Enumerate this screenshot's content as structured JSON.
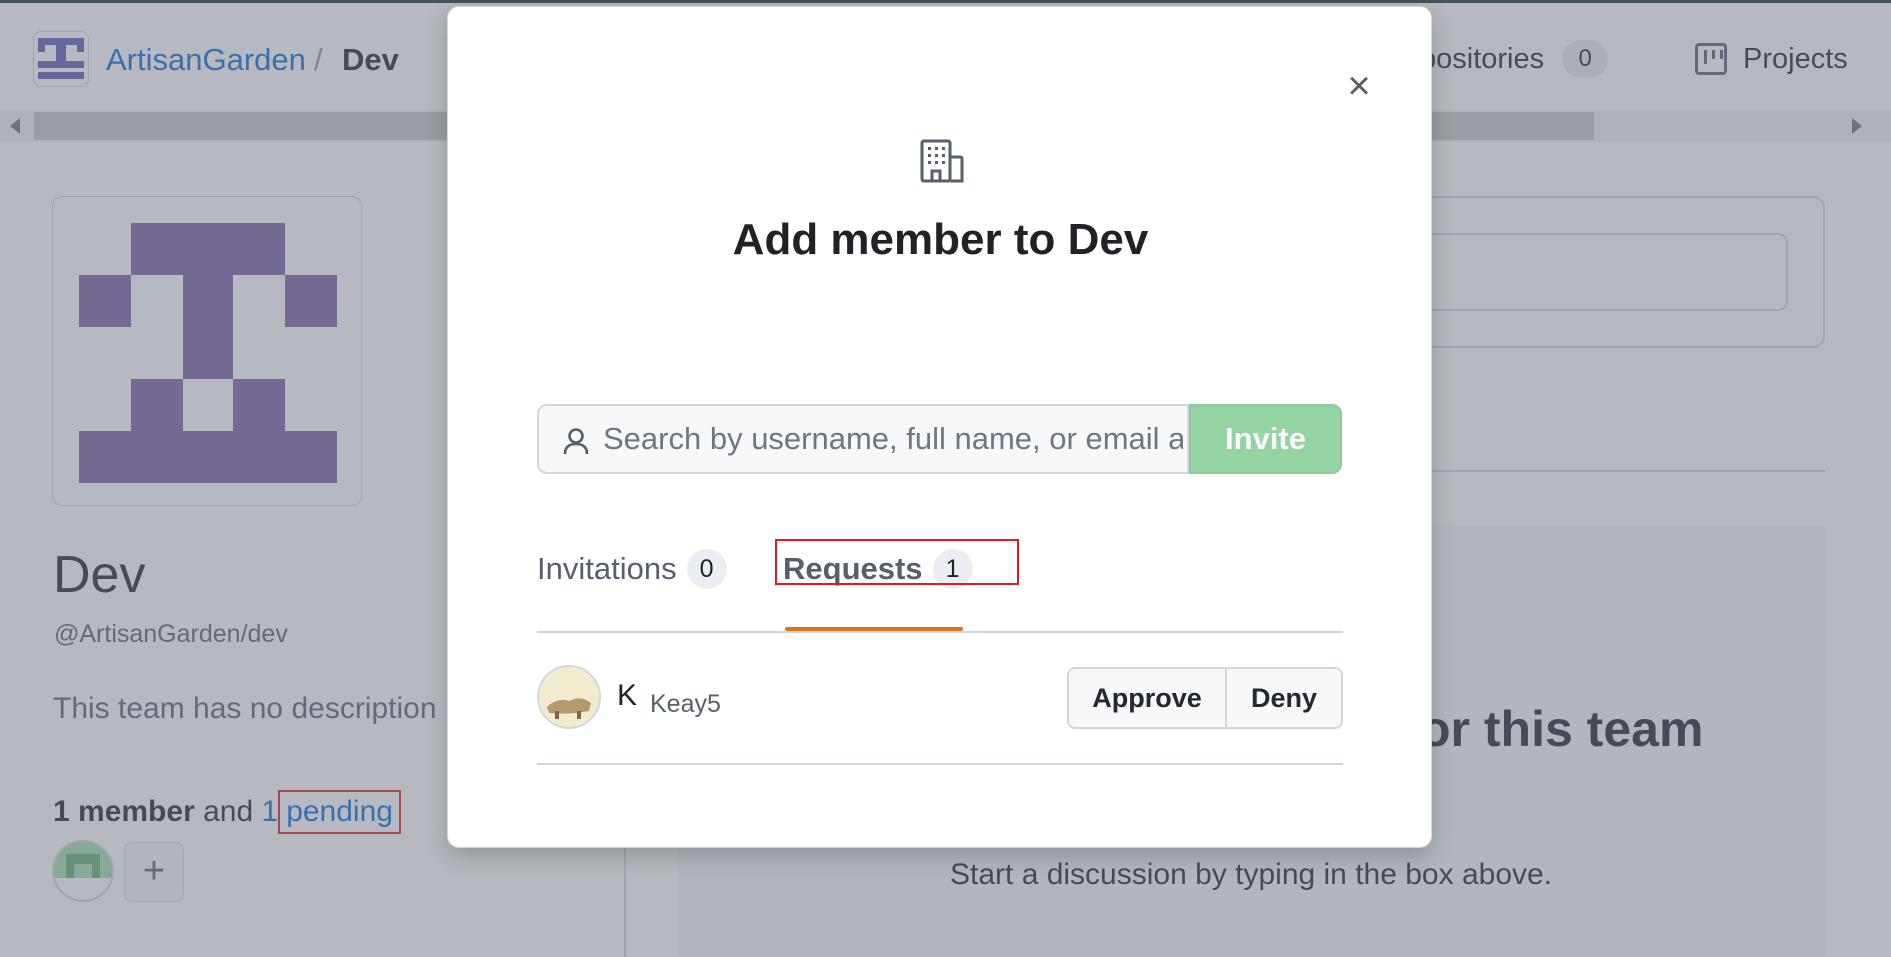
{
  "header": {
    "org_name": "ArtisanGarden",
    "separator": "/",
    "team_name": "Dev",
    "nav": {
      "repositories_label": "positories",
      "repositories_count": "0",
      "projects_label": "Projects"
    }
  },
  "team": {
    "name": "Dev",
    "handle": "@ArtisanGarden/dev",
    "description": "This team has no description",
    "members": {
      "count_label": "1 member",
      "and": "and",
      "pending_count": "1",
      "pending_label": "pending"
    },
    "add_member_glyph": "+"
  },
  "background": {
    "heading": "or this team",
    "subtext": "Start a discussion by typing in the box above."
  },
  "modal": {
    "title": "Add member to Dev",
    "close_glyph": "×",
    "icon": "organization-icon",
    "search": {
      "placeholder": "Search by username, full name, or email a",
      "value": ""
    },
    "invite_label": "Invite",
    "tabs": [
      {
        "label": "Invitations",
        "count": "0"
      },
      {
        "label": "Requests",
        "count": "1"
      }
    ],
    "requests": [
      {
        "initial": "K",
        "login": "Keay5",
        "approve_label": "Approve",
        "deny_label": "Deny"
      }
    ]
  },
  "colors": {
    "link": "#0969da",
    "invite_disabled": "#94d3a2",
    "tab_underline": "#d97515",
    "highlight": "#e5191f",
    "avatar_purple": "#7b5ea7"
  }
}
